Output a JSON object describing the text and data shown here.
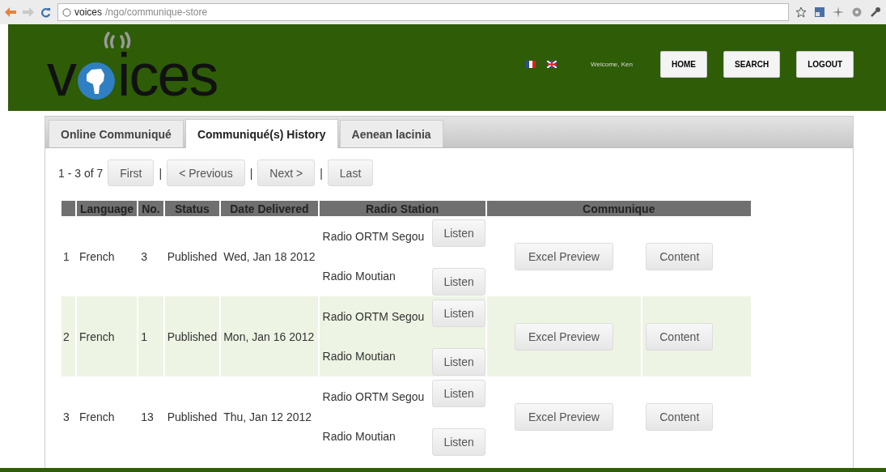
{
  "browser": {
    "url_host": "voices",
    "url_path": "/ngo/communique-store"
  },
  "header": {
    "logo_start": "v",
    "logo_end": "ices",
    "welcome": "Welcome, Ken",
    "nav": [
      "HOME",
      "SEARCH",
      "LOGOUT"
    ]
  },
  "tabs": [
    {
      "label": "Online Communiqué",
      "selected": false
    },
    {
      "label": "Communiqué(s) History",
      "selected": true
    },
    {
      "label": "Aenean lacinia",
      "selected": false
    }
  ],
  "pager": {
    "summary": "1 - 3 of 7",
    "separator": "|",
    "buttons": [
      "First",
      "< Previous",
      "Next >",
      "Last"
    ]
  },
  "table": {
    "columns": [
      "Language",
      "No.",
      "Status",
      "Date Delivered",
      "Radio Station",
      "Communique"
    ],
    "rows": [
      {
        "index": "1",
        "language": "French",
        "no": "3",
        "status": "Published",
        "date": "Wed, Jan 18 2012",
        "highlighted": false,
        "stations": [
          {
            "name": "Radio ORTM Segou",
            "action": "Listen"
          },
          {
            "name": "Radio Moutian",
            "action": "Listen"
          }
        ],
        "buttons": [
          "Excel Preview",
          "Content"
        ]
      },
      {
        "index": "2",
        "language": "French",
        "no": "1",
        "status": "Published",
        "date": "Mon, Jan 16 2012",
        "highlighted": true,
        "stations": [
          {
            "name": "Radio ORTM Segou",
            "action": "Listen"
          },
          {
            "name": "Radio Moutian",
            "action": "Listen"
          }
        ],
        "buttons": [
          "Excel Preview",
          "Content"
        ]
      },
      {
        "index": "3",
        "language": "French",
        "no": "13",
        "status": "Published",
        "date": "Thu, Jan 12 2012",
        "highlighted": false,
        "stations": [
          {
            "name": "Radio ORTM Segou",
            "action": "Listen"
          },
          {
            "name": "Radio Moutian",
            "action": "Listen"
          }
        ],
        "buttons": [
          "Excel Preview",
          "Content"
        ]
      }
    ]
  }
}
